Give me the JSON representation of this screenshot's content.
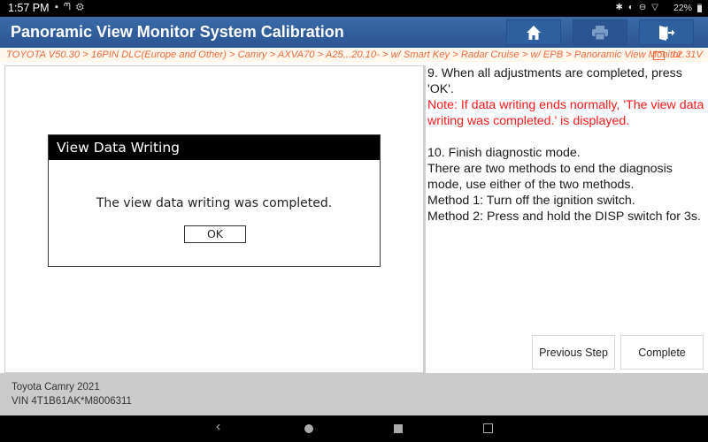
{
  "status_bar": {
    "time": "1:57 PM",
    "left_icons": [
      "image-icon",
      "usb-icon",
      "settings-icon"
    ],
    "right_icons": [
      "bluetooth-icon",
      "vibrate-icon",
      "dnd-icon",
      "wifi-icon"
    ],
    "battery": "22%"
  },
  "header": {
    "title": "Panoramic View Monitor System Calibration",
    "buttons": [
      {
        "name": "home-icon",
        "enabled": true
      },
      {
        "name": "print-icon",
        "enabled": false
      },
      {
        "name": "exit-icon",
        "enabled": true
      }
    ]
  },
  "breadcrumb": {
    "path": "TOYOTA V50.30 > 16PIN DLC(Europe and Other) > Camry > AXVA70 > A25...20.10- > w/ Smart Key > Radar Cruise > w/ EPB > Panoramic View Monitor",
    "voltage": "12.31V"
  },
  "dialog": {
    "title": "View Data Writing",
    "message": "The view data writing was completed.",
    "ok_label": "OK"
  },
  "instructions": {
    "step9": "9. When all adjustments are completed, press 'OK'.",
    "note": "Note: If data writing ends normally, 'The view data writing was completed.' is displayed.",
    "step10_title": "10. Finish diagnostic mode.",
    "step10_body": "There are two methods to end the diagnosis mode, use either of the two methods.",
    "method1": "Method 1: Turn off the ignition switch.",
    "method2": "Method 2: Press and hold the DISP switch for 3s."
  },
  "buttons": {
    "previous": "Previous Step",
    "complete": "Complete"
  },
  "vehicle": {
    "model": "Toyota Camry 2021",
    "vin": "VIN 4T1B61AK*M8006311"
  },
  "nav_bar": {
    "back_glyph": "‹"
  }
}
